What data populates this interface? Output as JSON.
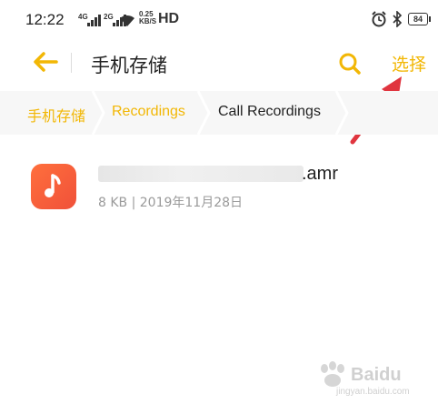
{
  "status_bar": {
    "time": "12:22",
    "sim1": "4G",
    "sim2": "2G",
    "speed_value": "0.25",
    "speed_unit": "KB/S",
    "hd_label": "HD",
    "battery": "84"
  },
  "header": {
    "title": "手机存储",
    "select_label": "选择"
  },
  "breadcrumbs": [
    {
      "label": "手机存储"
    },
    {
      "label": "Recordings"
    },
    {
      "label": "Call Recordings"
    }
  ],
  "files": [
    {
      "name_suffix": ".amr",
      "meta": "8 KB | 2019年11月28日"
    }
  ],
  "watermark": {
    "brand": "Baidu",
    "sub": "jingyan.baidu.com"
  },
  "colors": {
    "accent": "#f2b705",
    "icon_bg": "#f0513a",
    "annotation_arrow": "#e0353f"
  }
}
